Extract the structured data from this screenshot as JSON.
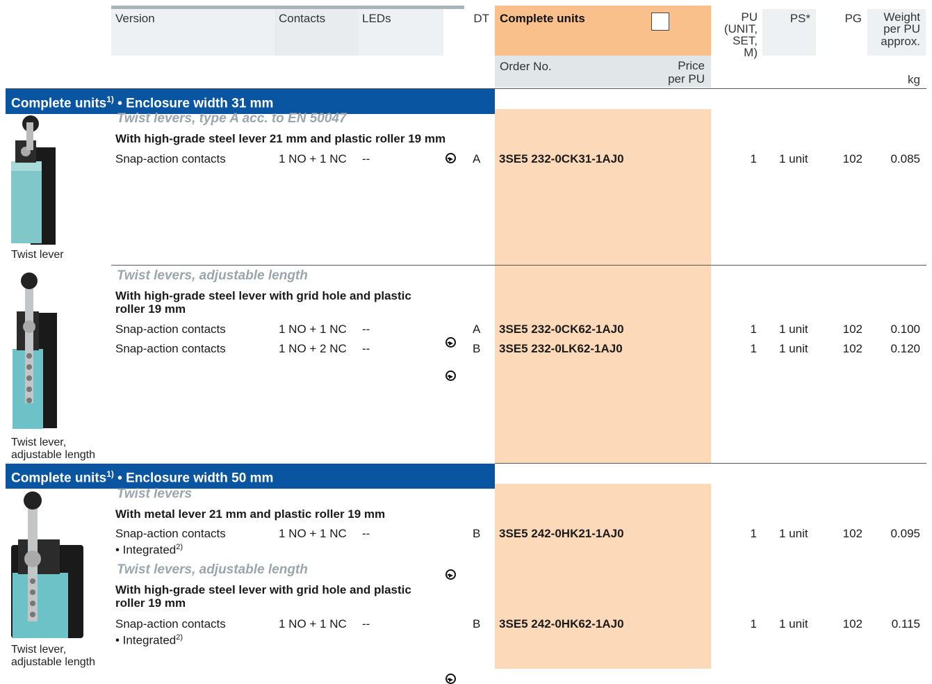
{
  "header": {
    "version": "Version",
    "contacts": "Contacts",
    "leds": "LEDs",
    "dt": "DT",
    "complete_units": "Complete units",
    "order_no": "Order No.",
    "price_line1": "Price",
    "price_line2": "per PU",
    "pu_line1": "PU",
    "pu_line2": "(UNIT,",
    "pu_line3": "SET,",
    "pu_line4": "M)",
    "ps": "PS*",
    "pg": "PG",
    "weight_line1": "Weight",
    "weight_line2": "per PU",
    "weight_line3": "approx.",
    "kg": "kg"
  },
  "sections": [
    {
      "title": "Complete units",
      "title_sup": "1)",
      "title_rest": " • Enclosure width 31 mm",
      "groups": [
        {
          "subtitle": "Twist levers, type A acc. to EN 50047",
          "desc": "With high-grade steel lever 21 mm and plastic roller 19 mm",
          "caption": "Twist lever",
          "rows": [
            {
              "version": "Snap-action contacts",
              "contacts": "1 NO + 1 NC",
              "leds": "--",
              "dt": "A",
              "order": "3SE5 232-0CK31-1AJ0",
              "pu": "1",
              "ps": "1 unit",
              "pg": "102",
              "weight": "0.085"
            }
          ]
        },
        {
          "subtitle": "Twist levers, adjustable length",
          "desc_line1": "With high-grade steel lever with grid hole and plastic",
          "desc_line2": "roller 19 mm",
          "caption_line1": "Twist lever,",
          "caption_line2": "adjustable length",
          "rows": [
            {
              "version": "Snap-action contacts",
              "contacts": "1 NO + 1 NC",
              "leds": "--",
              "dt": "A",
              "order": "3SE5 232-0CK62-1AJ0",
              "pu": "1",
              "ps": "1 unit",
              "pg": "102",
              "weight": "0.100"
            },
            {
              "version": "Snap-action contacts",
              "contacts": "1 NO + 2 NC",
              "leds": "--",
              "dt": "B",
              "order": "3SE5 232-0LK62-1AJ0",
              "pu": "1",
              "ps": "1 unit",
              "pg": "102",
              "weight": "0.120"
            }
          ]
        }
      ]
    },
    {
      "title": "Complete units",
      "title_sup": "1)",
      "title_rest": " • Enclosure width 50 mm",
      "groups": [
        {
          "subtitle": "Twist levers",
          "desc": "With metal lever 21 mm and plastic roller 19 mm",
          "rows": [
            {
              "version": "Snap-action contacts",
              "version2": "• Integrated",
              "version2_sup": "2)",
              "contacts": "1 NO + 1 NC",
              "leds": "--",
              "dt": "B",
              "order": "3SE5 242-0HK21-1AJ0",
              "pu": "1",
              "ps": "1 unit",
              "pg": "102",
              "weight": "0.095"
            }
          ]
        },
        {
          "subtitle": "Twist levers, adjustable length",
          "desc_line1": "With high-grade steel lever with grid hole and plastic",
          "desc_line2": "roller 19 mm",
          "caption_line1": "Twist lever,",
          "caption_line2": "adjustable length",
          "rows": [
            {
              "version": "Snap-action contacts",
              "version2": "• Integrated",
              "version2_sup": "2)",
              "contacts": "1 NO + 1 NC",
              "leds": "--",
              "dt": "B",
              "order": "3SE5 242-0HK62-1AJ0",
              "pu": "1",
              "ps": "1 unit",
              "pg": "102",
              "weight": "0.115"
            }
          ]
        }
      ]
    }
  ],
  "colors": {
    "section_blue": "#0a55a2",
    "order_orange": "#fcd9b8",
    "header_orange": "#f9c08c",
    "subtitle_gray": "#9aa6ad"
  }
}
